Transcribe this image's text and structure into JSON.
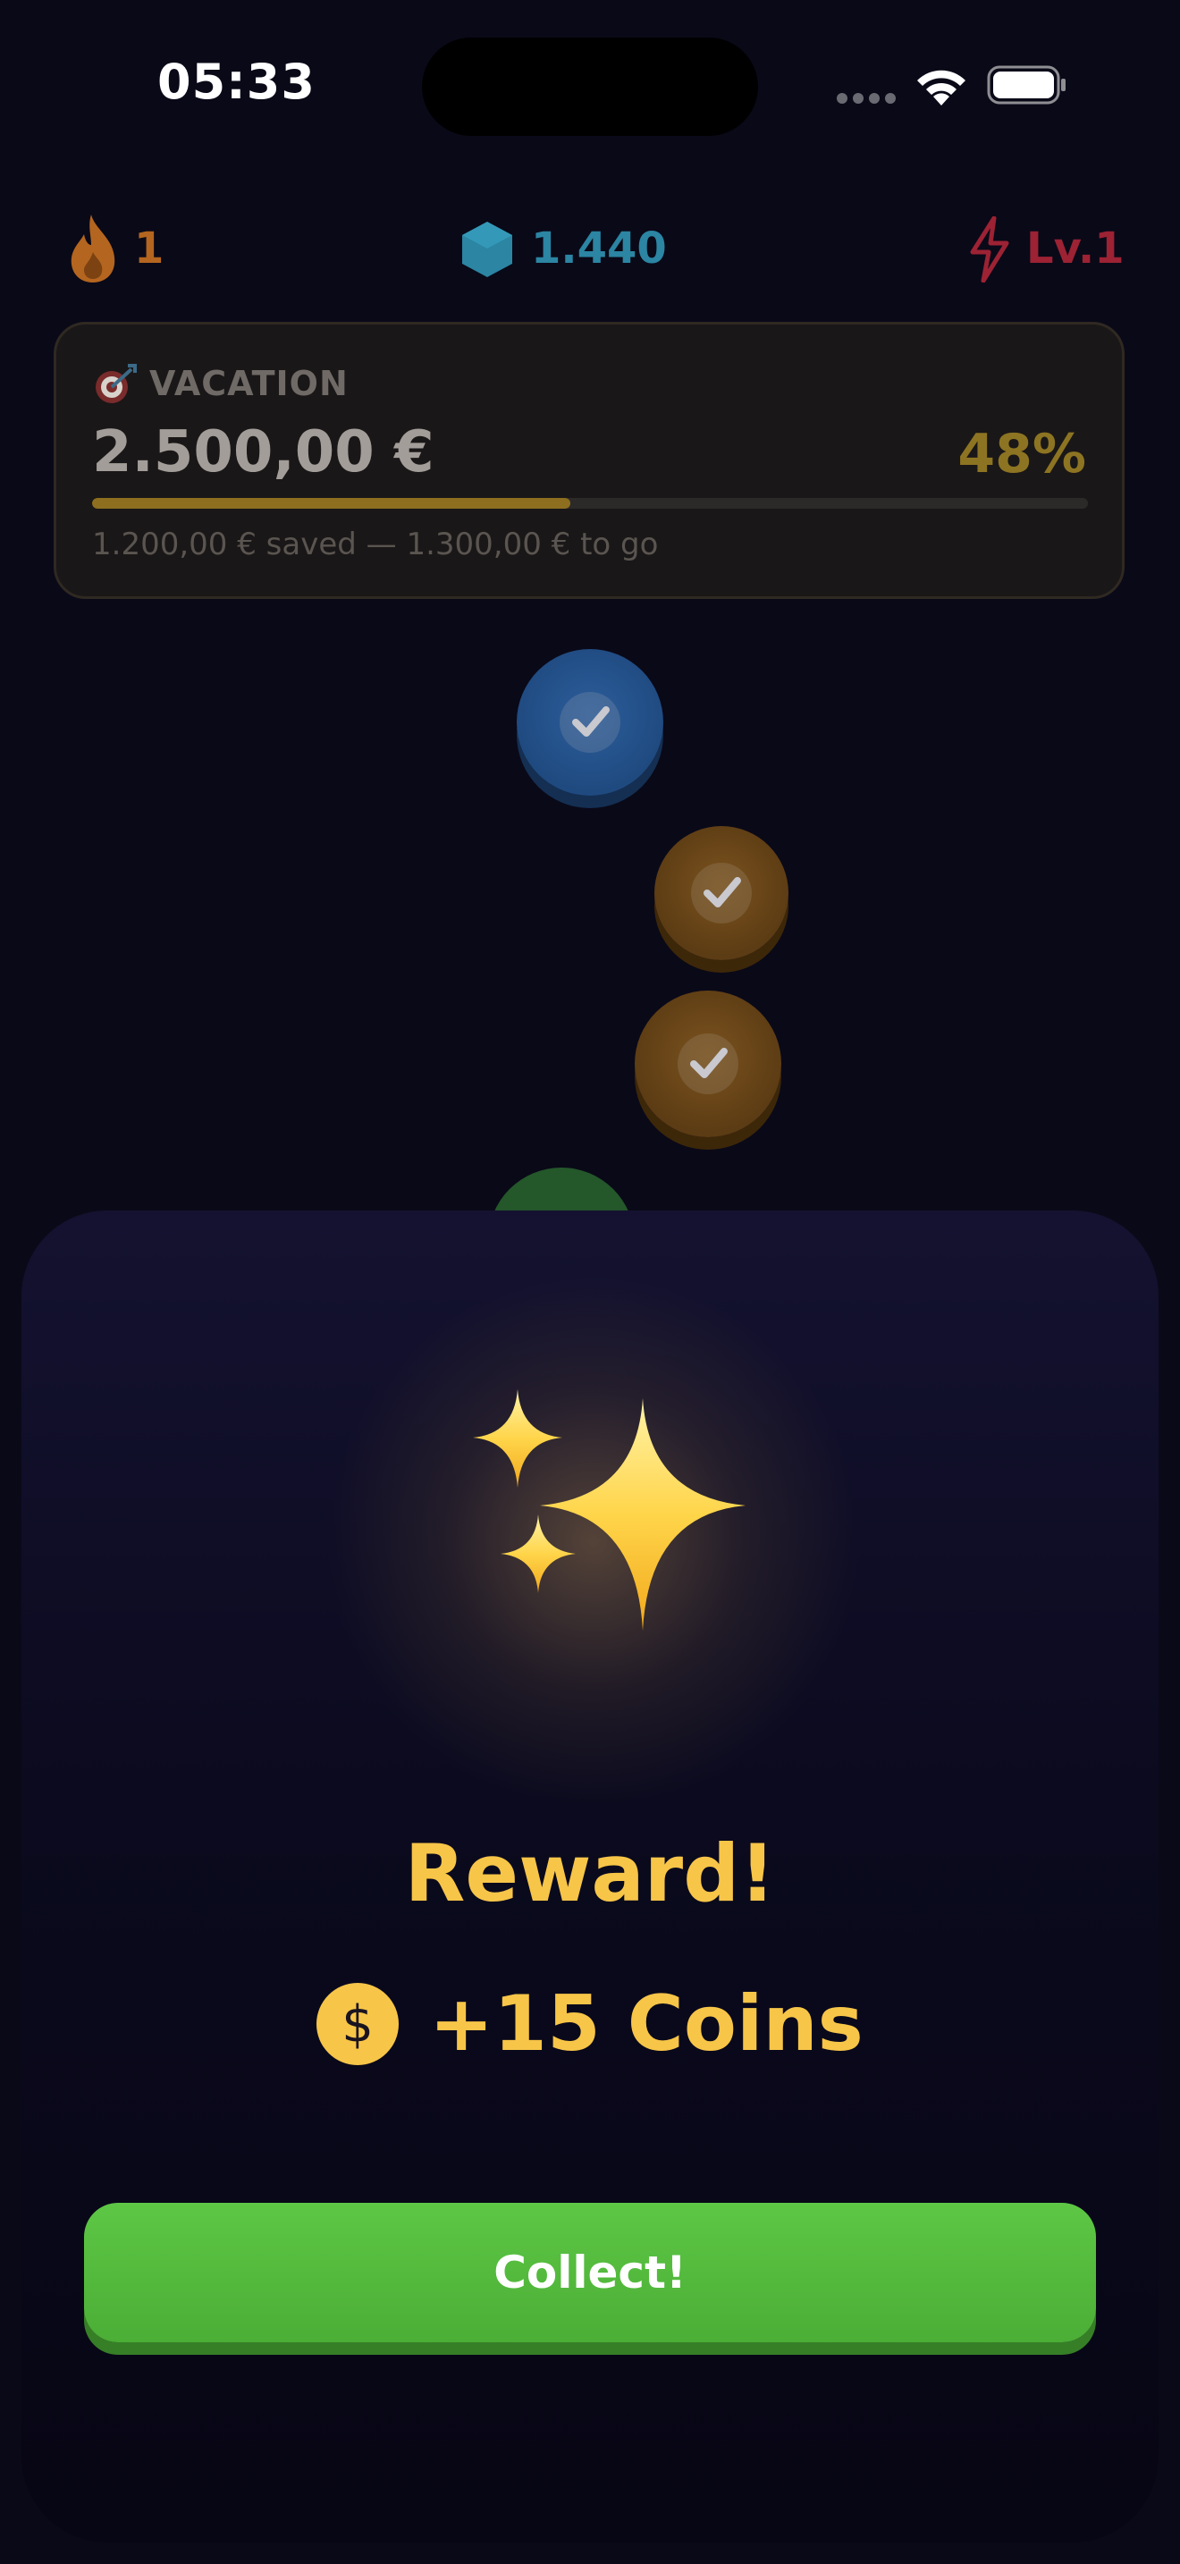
{
  "status_bar": {
    "time": "05:33",
    "icons": [
      "signal-icon",
      "wifi-icon",
      "battery-icon"
    ]
  },
  "stats": {
    "streak": {
      "icon": "flame-icon",
      "value": "1",
      "color": "#b4651f"
    },
    "gems": {
      "icon": "hexagon-gem-icon",
      "value": "1.440",
      "color": "#2b85a3"
    },
    "level": {
      "icon": "lightning-icon",
      "value": "Lv.1",
      "color": "#9c2234"
    }
  },
  "goal": {
    "icon": "dart-target-icon",
    "name": "VACATION",
    "amount": "2.500,00 €",
    "percent_label": "48%",
    "progress": 0.48,
    "saved_text": "1.200,00 € saved — 1.300,00 € to go"
  },
  "path_nodes": [
    {
      "state": "completed",
      "color": "blue"
    },
    {
      "state": "completed",
      "color": "bronze"
    },
    {
      "state": "completed",
      "color": "bronze"
    },
    {
      "state": "current",
      "color": "green"
    }
  ],
  "reward": {
    "icon": "sparkles-icon",
    "title": "Reward!",
    "coin_icon": "dollar-coin-icon",
    "coin_symbol": "$",
    "amount": "+15 Coins",
    "button_label": "Collect!",
    "accent_color": "#f7c548",
    "button_color": "#5dc745"
  }
}
